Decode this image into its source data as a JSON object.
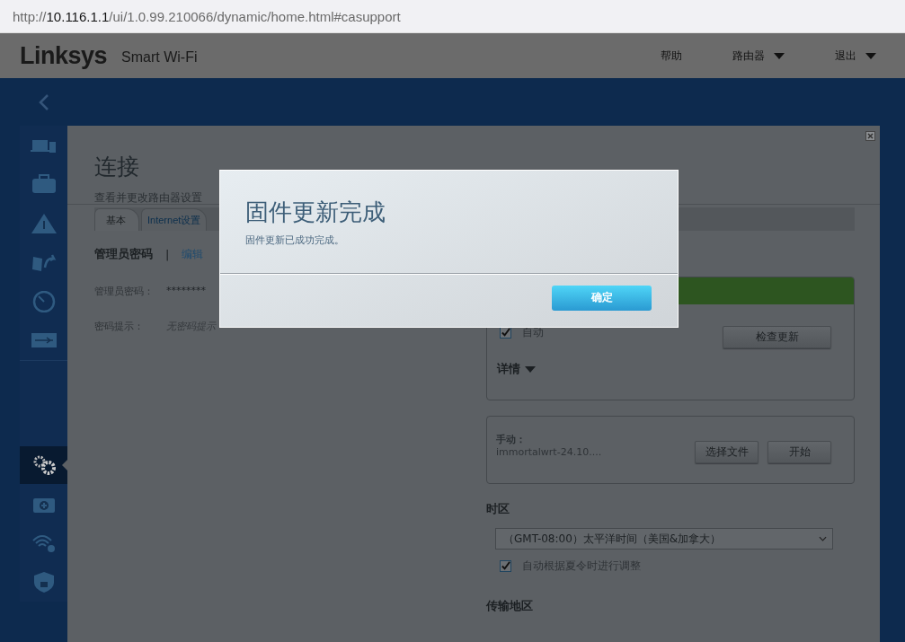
{
  "address_bar": {
    "url": "http://**10.116.1.1**/ui/1.0.99.210066/dynamic/home.html#casupport"
  },
  "header": {
    "logo": "Linksys",
    "product": "Smart Wi-Fi",
    "nav": [
      {
        "label": "帮助",
        "dropdown": false
      },
      {
        "label": "路由器",
        "dropdown": true
      },
      {
        "label": "退出",
        "dropdown": true
      }
    ]
  },
  "sidebar": {
    "items": [
      {
        "selected": false
      },
      {
        "selected": false
      },
      {
        "selected": false
      },
      {
        "selected": false
      },
      {
        "selected": false
      },
      {
        "selected": false
      },
      {
        "selected": true
      },
      {
        "selected": false
      },
      {
        "selected": false
      },
      {
        "selected": false
      }
    ]
  },
  "page": {
    "title": "连接",
    "subtitle": "查看并更改路由器设置",
    "tabs": [
      {
        "label": "基本",
        "selected": true
      },
      {
        "label": "Internet设置",
        "selected": false
      }
    ],
    "admin": {
      "heading": "管理员密码",
      "separator": "|",
      "edit": "编辑",
      "fields": [
        {
          "label": "管理员密码：",
          "value": "********",
          "italic": false
        },
        {
          "label": "密码提示：",
          "value": "无密码提示",
          "italic": true
        }
      ]
    },
    "auto_update": {
      "label": "自动",
      "checked": true,
      "check_button": "检查更新",
      "details": "详情"
    },
    "manual": {
      "label": "手动：",
      "file": "immortalwrt-24.10....",
      "buttons": [
        "选择文件",
        "开始"
      ]
    },
    "timezone": {
      "heading": "时区",
      "value": "（GMT-08:00）太平洋时间（美国&加拿大）",
      "dst": {
        "label": "自动根据夏令时进行调整",
        "checked": true
      }
    },
    "region": {
      "heading": "传输地区"
    }
  },
  "dialog": {
    "title": "固件更新完成",
    "message": "固件更新已成功完成。",
    "button": "确定"
  }
}
